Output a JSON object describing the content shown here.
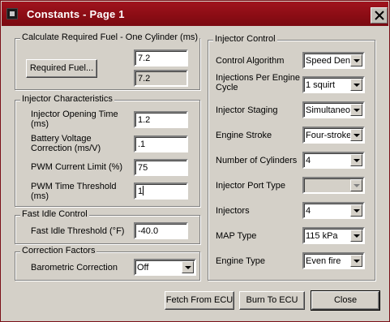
{
  "window": {
    "title": "Constants - Page 1"
  },
  "required_fuel": {
    "legend": "Calculate Required Fuel - One Cylinder (ms)",
    "button_label": "Required Fuel...",
    "value": "7.2",
    "computed_value": "7.2"
  },
  "injector_characteristics": {
    "legend": "Injector Characteristics",
    "opening_time": {
      "label_1": "Injector Opening Time",
      "label_2": "(ms)",
      "value": "1.2"
    },
    "battery_correction": {
      "label_1": "Battery Voltage",
      "label_2": "Correction (ms/V)",
      "value": ".1"
    },
    "pwm_current_limit": {
      "label": "PWM Current Limit (%)",
      "value": "75"
    },
    "pwm_time_threshold": {
      "label_1": "PWM Time Threshold",
      "label_2": "(ms)",
      "value": "1"
    }
  },
  "fast_idle": {
    "legend": "Fast Idle Control",
    "threshold": {
      "label": "Fast Idle Threshold (°F)",
      "value": "-40.0"
    }
  },
  "correction_factors": {
    "legend": "Correction Factors",
    "barometric": {
      "label": "Barometric Correction",
      "value": "Off"
    }
  },
  "injector_control": {
    "legend": "Injector Control",
    "control_algorithm": {
      "label": "Control Algorithm",
      "value": "Speed Density"
    },
    "injections_per_cycle": {
      "label_1": "Injections Per Engine",
      "label_2": "Cycle",
      "value": "1 squirt"
    },
    "injector_staging": {
      "label": "Injector Staging",
      "value": "Simultaneous"
    },
    "engine_stroke": {
      "label": "Engine Stroke",
      "value": "Four-stroke"
    },
    "num_cylinders": {
      "label": "Number of Cylinders",
      "value": "4"
    },
    "injector_port_type": {
      "label": "Injector Port Type",
      "value": ""
    },
    "injectors": {
      "label": "Injectors",
      "value": "4"
    },
    "map_type": {
      "label": "MAP Type",
      "value": "115 kPa"
    },
    "engine_type": {
      "label": "Engine Type",
      "value": "Even fire"
    }
  },
  "footer": {
    "fetch_label": "Fetch From ECU",
    "burn_label": "Burn To ECU",
    "close_label": "Close"
  },
  "icons": {
    "app": "app-window-icon",
    "close": "close-icon",
    "dropdown": "chevron-down-icon"
  },
  "colors": {
    "titlebar": "#8a0c14",
    "dialog_face": "#d4d0c8",
    "title_text": "#ffffff"
  }
}
